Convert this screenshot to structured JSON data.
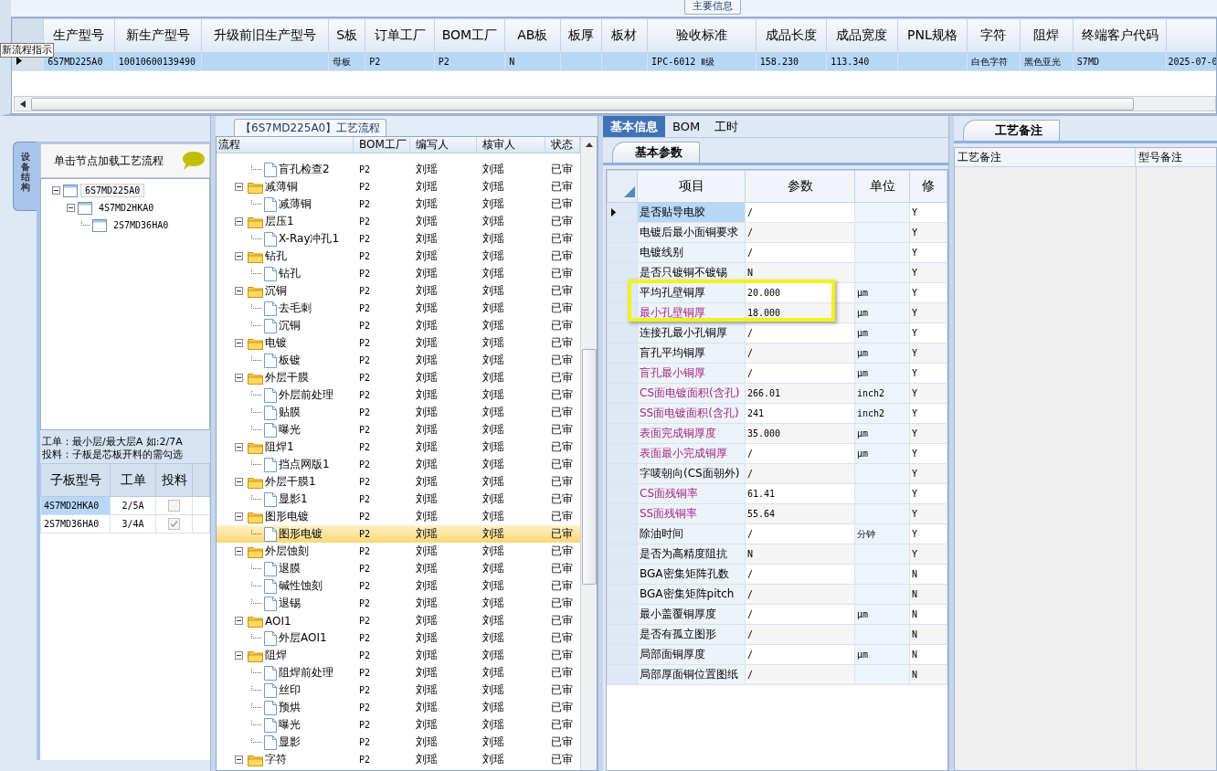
{
  "main_info": {
    "title": "主要信息",
    "tooltip": "新流程指示",
    "columns": [
      "生产型号",
      "新生产型号",
      "升级前旧生产型号",
      "S板",
      "订单工厂",
      "BOM工厂",
      "AB板",
      "板厚",
      "板材",
      "验收标准",
      "成品长度",
      "成品宽度",
      "PNL规格",
      "字符",
      "阻焊",
      "终端客户代码"
    ],
    "rows": [
      {
        "selected": true,
        "cells": [
          "6S7MD225A0",
          "10010600139490",
          null,
          "母板",
          "P2",
          "P2",
          "N",
          null,
          null,
          "IPC-6012 Ⅱ级",
          "158.230",
          "113.340",
          null,
          "白色字符",
          "黑色亚光",
          "S7MD",
          "2025-07-0"
        ]
      }
    ]
  },
  "structure": {
    "side_tab": "设备结构",
    "hint": "单击节点加载工艺流程",
    "tree": [
      {
        "label": "6S7MD225A0",
        "selected": true,
        "children": [
          {
            "label": "4S7MD2HKA0",
            "selected": false,
            "children": [
              {
                "label": "2S7MD36HA0",
                "selected": false
              }
            ]
          }
        ]
      }
    ],
    "notes": [
      "工单：最小层/最大层A 如:2/7A",
      "投料：子板是芯板开料的需勾选"
    ],
    "sub_boards": {
      "columns": [
        "子板型号",
        "工单",
        "投料"
      ],
      "rows": [
        {
          "model": "4S7MD2HKA0",
          "order": "2/5A",
          "checked": false,
          "selected": true
        },
        {
          "model": "2S7MD36HA0",
          "order": "3/4A",
          "checked": true,
          "selected": false
        }
      ]
    }
  },
  "flow": {
    "title": "【6S7MD225A0】工艺流程",
    "columns": [
      "流程",
      "BOM工厂",
      "编写人",
      "核审人",
      "状态"
    ],
    "rows": [
      {
        "kind": "step",
        "label": "盲孔检查2",
        "bom": "P2",
        "author": "刘瑶",
        "reviewer": "刘瑶",
        "status": "已审",
        "selected": false
      },
      {
        "kind": "group",
        "label": "减薄铜",
        "bom": "P2",
        "author": "刘瑶",
        "reviewer": "刘瑶",
        "status": "已审",
        "selected": false,
        "children": [
          {
            "kind": "step",
            "label": "减薄铜",
            "bom": "P2",
            "author": "刘瑶",
            "reviewer": "刘瑶",
            "status": "已审",
            "selected": false
          }
        ]
      },
      {
        "kind": "group",
        "label": "层压1",
        "bom": "P2",
        "author": "刘瑶",
        "reviewer": "刘瑶",
        "status": "已审",
        "selected": false,
        "children": [
          {
            "kind": "step",
            "label": "X-Ray冲孔1",
            "bom": "P2",
            "author": "刘瑶",
            "reviewer": "刘瑶",
            "status": "已审",
            "selected": false
          }
        ]
      },
      {
        "kind": "group",
        "label": "钻孔",
        "bom": "P2",
        "author": "刘瑶",
        "reviewer": "刘瑶",
        "status": "已审",
        "selected": false,
        "children": [
          {
            "kind": "step",
            "label": "钻孔",
            "bom": "P2",
            "author": "刘瑶",
            "reviewer": "刘瑶",
            "status": "已审",
            "selected": false
          }
        ]
      },
      {
        "kind": "group",
        "label": "沉铜",
        "bom": "P2",
        "author": "刘瑶",
        "reviewer": "刘瑶",
        "status": "已审",
        "selected": false,
        "children": [
          {
            "kind": "step",
            "label": "去毛刺",
            "bom": "P2",
            "author": "刘瑶",
            "reviewer": "刘瑶",
            "status": "已审",
            "selected": false
          },
          {
            "kind": "step",
            "label": "沉铜",
            "bom": "P2",
            "author": "刘瑶",
            "reviewer": "刘瑶",
            "status": "已审",
            "selected": false
          }
        ]
      },
      {
        "kind": "group",
        "label": "电镀",
        "bom": "P2",
        "author": "刘瑶",
        "reviewer": "刘瑶",
        "status": "已审",
        "selected": false,
        "children": [
          {
            "kind": "step",
            "label": "板镀",
            "bom": "P2",
            "author": "刘瑶",
            "reviewer": "刘瑶",
            "status": "已审",
            "selected": false
          }
        ]
      },
      {
        "kind": "group",
        "label": "外层干膜",
        "bom": "P2",
        "author": "刘瑶",
        "reviewer": "刘瑶",
        "status": "已审",
        "selected": false,
        "children": [
          {
            "kind": "step",
            "label": "外层前处理",
            "bom": "P2",
            "author": "刘瑶",
            "reviewer": "刘瑶",
            "status": "已审",
            "selected": false
          },
          {
            "kind": "step",
            "label": "贴膜",
            "bom": "P2",
            "author": "刘瑶",
            "reviewer": "刘瑶",
            "status": "已审",
            "selected": false
          },
          {
            "kind": "step",
            "label": "曝光",
            "bom": "P2",
            "author": "刘瑶",
            "reviewer": "刘瑶",
            "status": "已审",
            "selected": false
          }
        ]
      },
      {
        "kind": "group",
        "label": "阻焊1",
        "bom": "P2",
        "author": "刘瑶",
        "reviewer": "刘瑶",
        "status": "已审",
        "selected": false,
        "children": [
          {
            "kind": "step",
            "label": "挡点网版1",
            "bom": "P2",
            "author": "刘瑶",
            "reviewer": "刘瑶",
            "status": "已审",
            "selected": false
          }
        ]
      },
      {
        "kind": "group",
        "label": "外层干膜1",
        "bom": "P2",
        "author": "刘瑶",
        "reviewer": "刘瑶",
        "status": "已审",
        "selected": false,
        "children": [
          {
            "kind": "step",
            "label": "显影1",
            "bom": "P2",
            "author": "刘瑶",
            "reviewer": "刘瑶",
            "status": "已审",
            "selected": false
          }
        ]
      },
      {
        "kind": "group",
        "label": "图形电镀",
        "bom": "P2",
        "author": "刘瑶",
        "reviewer": "刘瑶",
        "status": "已审",
        "selected": false,
        "children": [
          {
            "kind": "step",
            "label": "图形电镀",
            "bom": "P2",
            "author": "刘瑶",
            "reviewer": "刘瑶",
            "status": "已审",
            "selected": true
          }
        ]
      },
      {
        "kind": "group",
        "label": "外层蚀刻",
        "bom": "P2",
        "author": "刘瑶",
        "reviewer": "刘瑶",
        "status": "已审",
        "selected": false,
        "children": [
          {
            "kind": "step",
            "label": "退膜",
            "bom": "P2",
            "author": "刘瑶",
            "reviewer": "刘瑶",
            "status": "已审",
            "selected": false
          },
          {
            "kind": "step",
            "label": "碱性蚀刻",
            "bom": "P2",
            "author": "刘瑶",
            "reviewer": "刘瑶",
            "status": "已审",
            "selected": false
          },
          {
            "kind": "step",
            "label": "退锡",
            "bom": "P2",
            "author": "刘瑶",
            "reviewer": "刘瑶",
            "status": "已审",
            "selected": false
          }
        ]
      },
      {
        "kind": "group",
        "label": "AOI1",
        "bom": "P2",
        "author": "刘瑶",
        "reviewer": "刘瑶",
        "status": "已审",
        "selected": false,
        "children": [
          {
            "kind": "step",
            "label": "外层AOI1",
            "bom": "P2",
            "author": "刘瑶",
            "reviewer": "刘瑶",
            "status": "已审",
            "selected": false
          }
        ]
      },
      {
        "kind": "group",
        "label": "阻焊",
        "bom": "P2",
        "author": "刘瑶",
        "reviewer": "刘瑶",
        "status": "已审",
        "selected": false,
        "children": [
          {
            "kind": "step",
            "label": "阻焊前处理",
            "bom": "P2",
            "author": "刘瑶",
            "reviewer": "刘瑶",
            "status": "已审",
            "selected": false
          },
          {
            "kind": "step",
            "label": "丝印",
            "bom": "P2",
            "author": "刘瑶",
            "reviewer": "刘瑶",
            "status": "已审",
            "selected": false
          },
          {
            "kind": "step",
            "label": "预烘",
            "bom": "P2",
            "author": "刘瑶",
            "reviewer": "刘瑶",
            "status": "已审",
            "selected": false
          },
          {
            "kind": "step",
            "label": "曝光",
            "bom": "P2",
            "author": "刘瑶",
            "reviewer": "刘瑶",
            "status": "已审",
            "selected": false
          },
          {
            "kind": "step",
            "label": "显影",
            "bom": "P2",
            "author": "刘瑶",
            "reviewer": "刘瑶",
            "status": "已审",
            "selected": false
          }
        ]
      },
      {
        "kind": "group",
        "label": "字符",
        "bom": "P2",
        "author": "刘瑶",
        "reviewer": "刘瑶",
        "status": "已审",
        "selected": false
      }
    ]
  },
  "details": {
    "tabs": [
      {
        "label": "基本信息",
        "selected": true
      },
      {
        "label": "BOM",
        "selected": false
      },
      {
        "label": "工时",
        "selected": false
      }
    ],
    "sub_tab": "基本参数",
    "columns": [
      "项目",
      "参数",
      "单位",
      "修"
    ],
    "rows": [
      {
        "item": "是否贴导电胶",
        "value": "/",
        "unit": null,
        "modified": "Y",
        "emphasized": false,
        "selected": true
      },
      {
        "item": "电镀后最小面铜要求",
        "value": "/",
        "unit": null,
        "modified": "Y",
        "emphasized": false,
        "selected": false
      },
      {
        "item": "电镀线别",
        "value": "/",
        "unit": null,
        "modified": "Y",
        "emphasized": false,
        "selected": false
      },
      {
        "item": "是否只镀铜不镀锡",
        "value": "N",
        "unit": null,
        "modified": "Y",
        "emphasized": false,
        "selected": false
      },
      {
        "item": "平均孔壁铜厚",
        "value": "20.000",
        "unit": "μm",
        "modified": "Y",
        "emphasized": false,
        "selected": false
      },
      {
        "item": "最小孔壁铜厚",
        "value": "18.000",
        "unit": "μm",
        "modified": "Y",
        "emphasized": true,
        "selected": false
      },
      {
        "item": "连接孔最小孔铜厚",
        "value": "/",
        "unit": "μm",
        "modified": "Y",
        "emphasized": false,
        "selected": false
      },
      {
        "item": "盲孔平均铜厚",
        "value": "/",
        "unit": "μm",
        "modified": "Y",
        "emphasized": false,
        "selected": false
      },
      {
        "item": "盲孔最小铜厚",
        "value": "/",
        "unit": "μm",
        "modified": "Y",
        "emphasized": true,
        "selected": false
      },
      {
        "item": "CS面电镀面积(含孔)",
        "value": "266.01",
        "unit": "inch2",
        "modified": "Y",
        "emphasized": true,
        "selected": false
      },
      {
        "item": "SS面电镀面积(含孔)",
        "value": "241",
        "unit": "inch2",
        "modified": "Y",
        "emphasized": true,
        "selected": false
      },
      {
        "item": "表面完成铜厚度",
        "value": "35.000",
        "unit": "μm",
        "modified": "Y",
        "emphasized": true,
        "selected": false
      },
      {
        "item": "表面最小完成铜厚",
        "value": "/",
        "unit": "μm",
        "modified": "Y",
        "emphasized": true,
        "selected": false
      },
      {
        "item": "字唛朝向(CS面朝外)",
        "value": "/",
        "unit": null,
        "modified": "Y",
        "emphasized": false,
        "selected": false
      },
      {
        "item": "CS面残铜率",
        "value": "61.41",
        "unit": null,
        "modified": "Y",
        "emphasized": true,
        "selected": false
      },
      {
        "item": "SS面残铜率",
        "value": "55.64",
        "unit": null,
        "modified": "Y",
        "emphasized": true,
        "selected": false
      },
      {
        "item": "除油时间",
        "value": "/",
        "unit": "分钟",
        "modified": "Y",
        "emphasized": false,
        "selected": false
      },
      {
        "item": "是否为高精度阻抗",
        "value": "N",
        "unit": null,
        "modified": "Y",
        "emphasized": false,
        "selected": false
      },
      {
        "item": "BGA密集矩阵孔数",
        "value": "/",
        "unit": null,
        "modified": "N",
        "emphasized": false,
        "selected": false
      },
      {
        "item": "BGA密集矩阵pitch",
        "value": "/",
        "unit": null,
        "modified": "N",
        "emphasized": false,
        "selected": false
      },
      {
        "item": "最小盖覆铜厚度",
        "value": "/",
        "unit": "μm",
        "modified": "N",
        "emphasized": false,
        "selected": false
      },
      {
        "item": "是否有孤立图形",
        "value": "/",
        "unit": null,
        "modified": "N",
        "emphasized": false,
        "selected": false
      },
      {
        "item": "局部面铜厚度",
        "value": "/",
        "unit": "μm",
        "modified": "N",
        "emphasized": false,
        "selected": false
      },
      {
        "item": "局部厚面铜位置图纸",
        "value": "/",
        "unit": null,
        "modified": "N",
        "emphasized": false,
        "selected": false
      }
    ]
  },
  "remarks": {
    "tab": "工艺备注",
    "columns": [
      "工艺备注",
      "型号备注"
    ]
  }
}
